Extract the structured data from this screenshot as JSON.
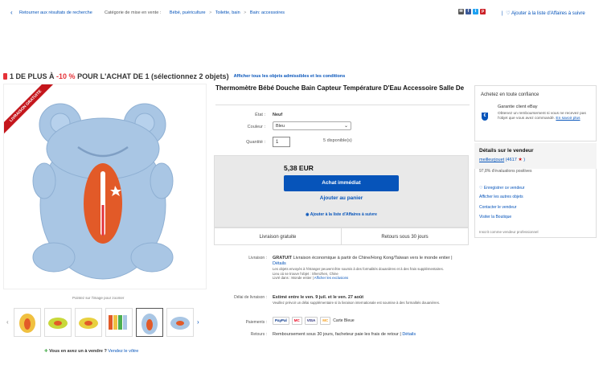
{
  "topbar": {
    "back_label": "Retourner aux résultats de recherche",
    "category_prefix": "Catégorie de mise en vente :",
    "breadcrumb": [
      "Bébé, puériculture",
      "Toilette, bain",
      "Bain: accessoires"
    ],
    "watch_label": "Ajouter à la liste d'Affaires à suivre"
  },
  "promo": {
    "part1": "1 DE PLUS À",
    "discount": "-10 %",
    "part2": "POUR L'ACHAT DE 1 (sélectionnez 2 objets)",
    "link": "Afficher tous les objets admissibles et les conditions"
  },
  "image": {
    "ribbon": "LIVRAISON GRATUITE",
    "caption": "Pointez sur l'image pour zoomer"
  },
  "vendre": {
    "question": "Vous en avez un à vendre ?",
    "link": "Vendez le vôtre"
  },
  "product": {
    "title": "Thermomètre Bébé Douche Bain Capteur Température D'Eau Accessoire Salle De",
    "etat_label": "État :",
    "etat_value": "Neuf",
    "couleur_label": "Couleur :",
    "couleur_value": "Bleu",
    "qty_label": "Quantité :",
    "qty_value": "1",
    "dispo": "5 disponible(s)"
  },
  "buy": {
    "price": "5,38 EUR",
    "buy_now": "Achat immédiat",
    "add_cart": "Ajouter au panier",
    "watch": "Ajouter à la liste d'Affaires à suivre",
    "shipping_free": "Livraison gratuite",
    "returns": "Retours sous 30 jours"
  },
  "details": {
    "livraison_label": "Livraison :",
    "livraison_free": "GRATUIT",
    "livraison_text": "Livraison économique à partir de Chine/Hong Kong/Taïwan vers le monde entier |",
    "livraison_link": "Détails",
    "livraison_note": "Les objets envoyés à l'étranger peuvent être soumis à des formalités douanières et à des frais supplémentaires.",
    "lieu_label": "Lieu où se trouve l'objet : Shenzhen, Chine",
    "livre_label": "Livré dans : Monde entier |",
    "livre_link": "Afficher les exclusions",
    "delai_label": "Délai de livraison :",
    "delai_text": "Estimé entre le ven. 9 juil. et le ven. 27 août",
    "delai_note": "Veuillez prévoir un délai supplémentaire si la livraison internationale est soumise à des formalités douanières.",
    "paiements_label": "Paiements :",
    "cards": [
      "PayPal",
      "MC",
      "VISA",
      "MC",
      "Carte Bleue"
    ],
    "retours_label": "Retours :",
    "retours_text": "Remboursement sous 30 jours, facheteur paie les frais de retour |",
    "retours_link": "Détails"
  },
  "confidence": {
    "title": "Achetez en toute confiance",
    "garantie": "Garantie client eBay",
    "garantie_desc": "Obtenez un remboursement si vous ne recevez pas l'objet que vous avez commandé.",
    "garantie_link": "En savoir plus"
  },
  "seller": {
    "title": "Détails sur le vendeur",
    "name": "meilleurjouet",
    "score": "(4617",
    "score_end": ")",
    "positive": "97,8% d'évaluations positives",
    "links": [
      "Enregistrer ce vendeur",
      "Afficher les autres objets",
      "Contacter le vendeur",
      "Visiter la Boutique"
    ],
    "type": "Inscrit comme vendeur professionnel"
  },
  "colors": {
    "link": "#0654ba",
    "promo_red": "#e53238",
    "frog_blue": "#a9c6e4",
    "thermo_orange": "#e25a28"
  }
}
